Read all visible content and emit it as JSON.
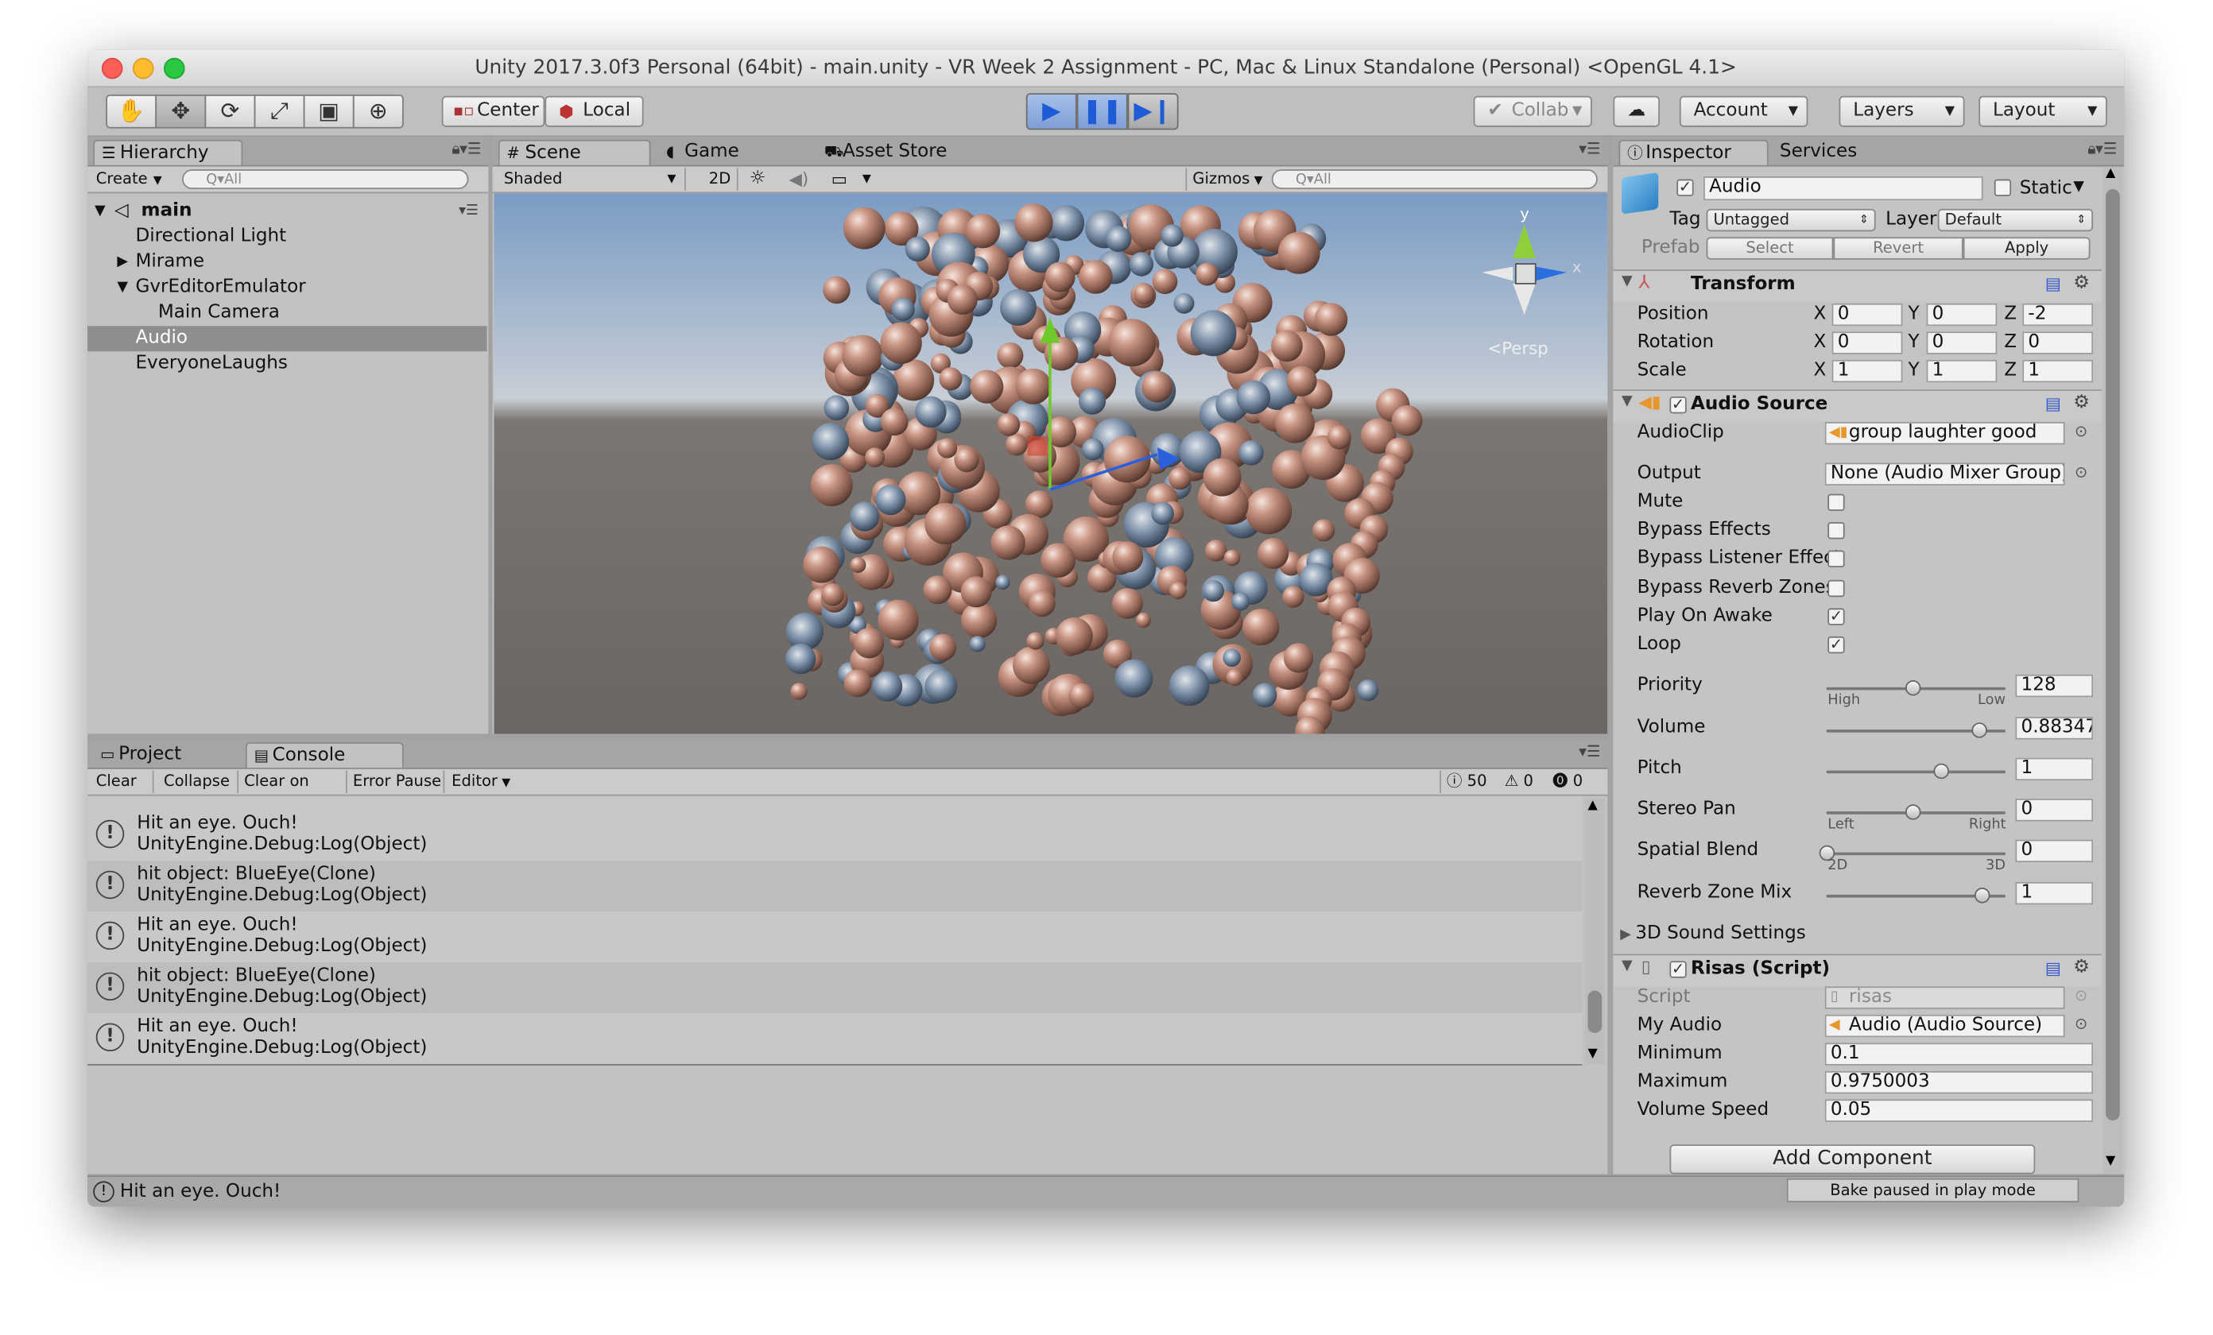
{
  "window": {
    "title": "Unity 2017.3.0f3 Personal (64bit) - main.unity - VR Week 2 Assignment - PC, Mac & Linux Standalone (Personal) <OpenGL 4.1>"
  },
  "toolbar": {
    "tools": [
      "hand-tool-icon",
      "move-tool-icon",
      "rotate-tool-icon",
      "scale-tool-icon",
      "rect-tool-icon",
      "transform-tool-icon"
    ],
    "pivot": "Center",
    "space": "Local",
    "collab": "Collab",
    "account": "Account",
    "layers": "Layers",
    "layout": "Layout",
    "play_state": "playing-paused-off"
  },
  "hierarchy": {
    "tab": "Hierarchy",
    "create": "Create",
    "search_placeholder": "Q▾All",
    "scene": "main",
    "items": [
      {
        "label": "Directional Light"
      },
      {
        "label": "Mirame"
      },
      {
        "label": "GvrEditorEmulator"
      },
      {
        "label": "Main Camera"
      },
      {
        "label": "Audio"
      },
      {
        "label": "EveryoneLaughs"
      }
    ]
  },
  "scene_view": {
    "tabs": [
      "Scene",
      "Game",
      "Asset Store"
    ],
    "shading": "Shaded",
    "mode_2d": "2D",
    "gizmos": "Gizmos",
    "search_placeholder": "Q▾All",
    "persp": "<Persp",
    "axis_y": "y",
    "axis_x": "x"
  },
  "console": {
    "tabs": [
      "Project",
      "Console"
    ],
    "buttons": [
      "Clear",
      "Collapse",
      "Clear on Play",
      "Error Pause",
      "Editor"
    ],
    "counts": {
      "logs": "50",
      "warnings": "0",
      "errors": "0"
    },
    "entries": [
      {
        "line1": "Hit an eye. Ouch!",
        "line2": "UnityEngine.Debug:Log(Object)"
      },
      {
        "line1": "hit object: BlueEye(Clone)",
        "line2": "UnityEngine.Debug:Log(Object)"
      },
      {
        "line1": "Hit an eye. Ouch!",
        "line2": "UnityEngine.Debug:Log(Object)"
      },
      {
        "line1": "hit object: BlueEye(Clone)",
        "line2": "UnityEngine.Debug:Log(Object)"
      },
      {
        "line1": "Hit an eye. Ouch!",
        "line2": "UnityEngine.Debug:Log(Object)"
      }
    ]
  },
  "statusbar": {
    "message": "Hit an eye. Ouch!",
    "bake": "Bake paused in play mode"
  },
  "inspector": {
    "tabs": [
      "Inspector",
      "Services"
    ],
    "object_name": "Audio",
    "static_label": "Static",
    "tag_label": "Tag",
    "tag_value": "Untagged",
    "layer_label": "Layer",
    "layer_value": "Default",
    "prefab_label": "Prefab",
    "prefab_buttons": [
      "Select",
      "Revert",
      "Apply"
    ],
    "transform": {
      "title": "Transform",
      "rows": [
        {
          "label": "Position",
          "x": "0",
          "y": "0",
          "z": "-2"
        },
        {
          "label": "Rotation",
          "x": "0",
          "y": "0",
          "z": "0"
        },
        {
          "label": "Scale",
          "x": "1",
          "y": "1",
          "z": "1"
        }
      ]
    },
    "audio_source": {
      "title": "Audio Source",
      "audioclip_label": "AudioClip",
      "audioclip_value": "group laughter good",
      "output_label": "Output",
      "output_value": "None (Audio Mixer Group)",
      "toggles": [
        {
          "label": "Mute",
          "checked": false
        },
        {
          "label": "Bypass Effects",
          "checked": false
        },
        {
          "label": "Bypass Listener Effect",
          "checked": false
        },
        {
          "label": "Bypass Reverb Zones",
          "checked": false
        },
        {
          "label": "Play On Awake",
          "checked": true
        },
        {
          "label": "Loop",
          "checked": true
        }
      ],
      "sliders": [
        {
          "label": "Priority",
          "value": "128",
          "fraction": 0.5,
          "left": "High",
          "right": "Low"
        },
        {
          "label": "Volume",
          "value": "0.88347",
          "fraction": 0.88347,
          "left": "",
          "right": ""
        },
        {
          "label": "Pitch",
          "value": "1",
          "fraction": 0.66,
          "left": "",
          "right": ""
        },
        {
          "label": "Stereo Pan",
          "value": "0",
          "fraction": 0.5,
          "left": "Left",
          "right": "Right"
        },
        {
          "label": "Spatial Blend",
          "value": "0",
          "fraction": 0.0,
          "left": "2D",
          "right": "3D"
        },
        {
          "label": "Reverb Zone Mix",
          "value": "1",
          "fraction": 0.9,
          "left": "",
          "right": ""
        }
      ],
      "sound3d": "3D Sound Settings"
    },
    "script": {
      "title": "Risas (Script)",
      "rows": [
        {
          "label": "Script",
          "value": "risas"
        },
        {
          "label": "My Audio",
          "value": "Audio (Audio Source)"
        },
        {
          "label": "Minimum",
          "value": "0.1"
        },
        {
          "label": "Maximum",
          "value": "0.9750003"
        },
        {
          "label": "Volume Speed",
          "value": "0.05"
        }
      ]
    },
    "add_component": "Add Component"
  },
  "colors": {
    "selection": "#8e8e8e",
    "accent": "#3a6fe0",
    "panel": "#c2c2c2"
  }
}
